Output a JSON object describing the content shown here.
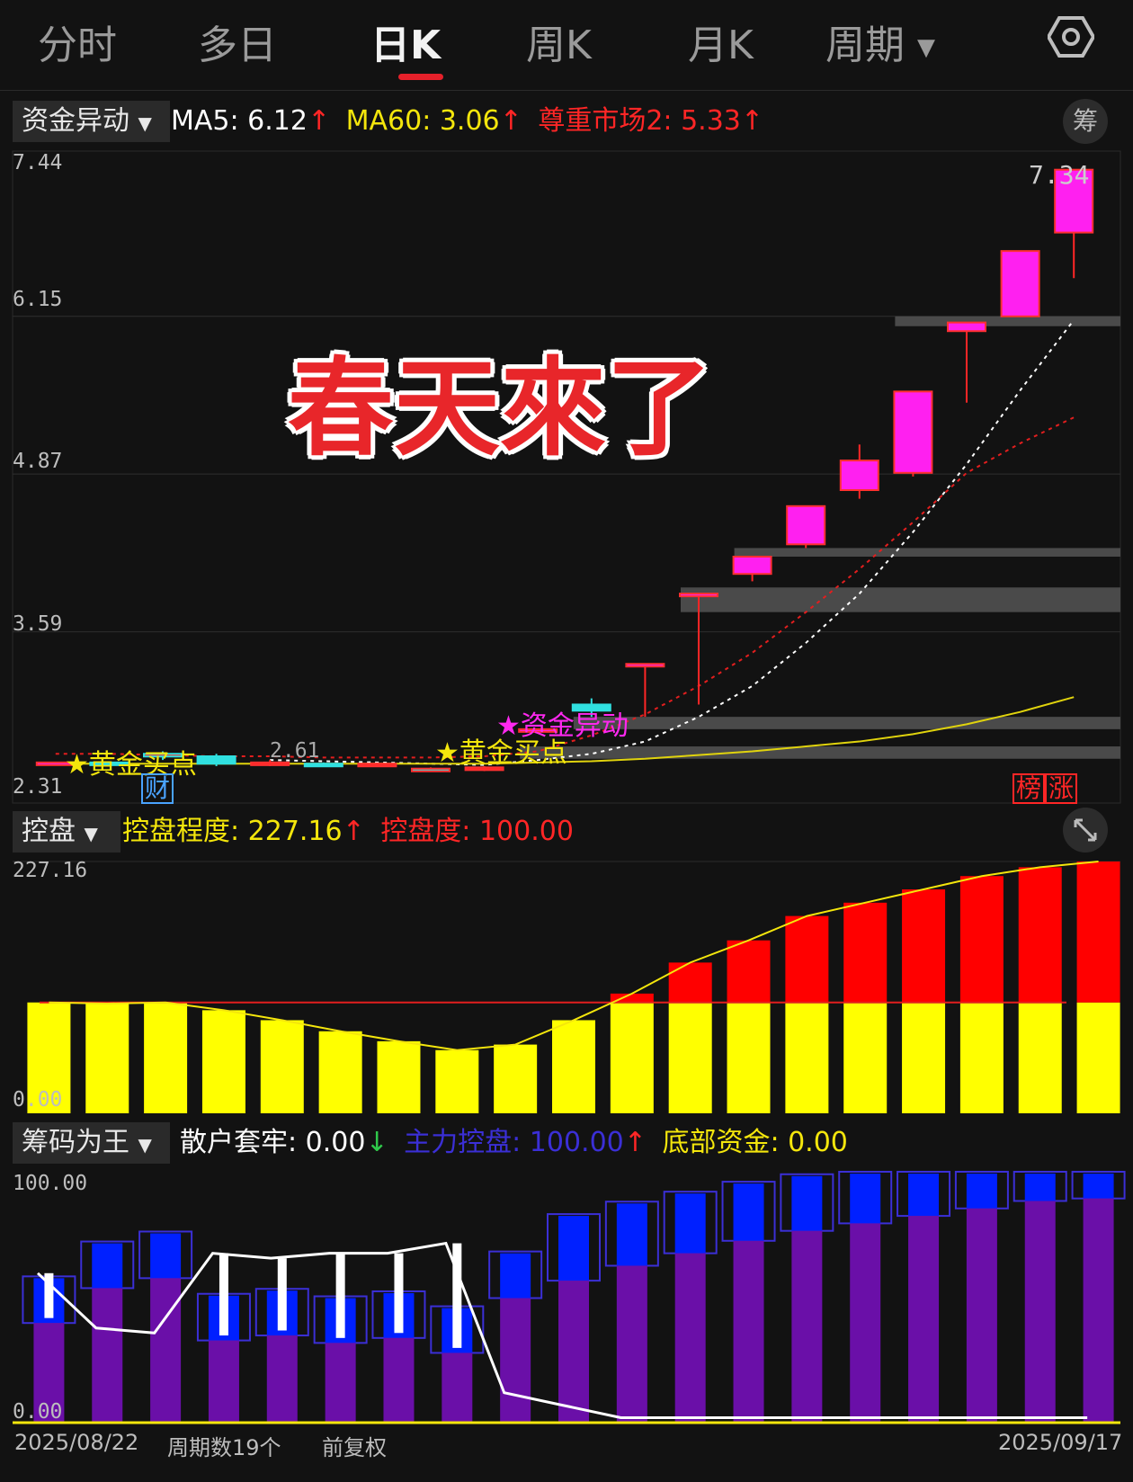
{
  "tabs": [
    {
      "label": "分时",
      "active": false
    },
    {
      "label": "多日",
      "active": false
    },
    {
      "label": "日K",
      "active": true
    },
    {
      "label": "周K",
      "active": false
    },
    {
      "label": "月K",
      "active": false
    },
    {
      "label": "周期",
      "active": false
    }
  ],
  "settings_icon": "gear-icon",
  "main_panel": {
    "selector": "资金异动",
    "indicators": [
      {
        "text": "MA5: 6.12",
        "color": "#ffffff",
        "arrow": "↑"
      },
      {
        "text": "MA60: 3.06",
        "color": "#f4e60c",
        "arrow": "↑"
      },
      {
        "text": "尊重市场2: 5.33",
        "color": "#ff2626",
        "arrow": "↑"
      }
    ],
    "button": "筹",
    "headline": "春天來了",
    "y_labels": [
      "7.44",
      "6.15",
      "4.87",
      "3.59",
      "2.31"
    ],
    "max_label": "7.34",
    "min_label": "2.61",
    "signals": [
      "黄金买点",
      "黄金买点",
      "资金异动"
    ],
    "badges": [
      "财",
      "榜",
      "涨"
    ]
  },
  "control_panel": {
    "selector": "控盘",
    "indicators": [
      {
        "text": "控盘程度: 227.16",
        "color": "#f4e60c",
        "arrow": "↑"
      },
      {
        "text": "控盘度: 100.00",
        "color": "#ff2626",
        "arrow": ""
      }
    ],
    "y_labels": [
      "227.16",
      "0.00"
    ],
    "expand_icon": "expand-icon"
  },
  "chip_panel": {
    "selector": "筹码为王",
    "indicators": [
      {
        "text": "散户套牢: 0.00",
        "color": "#ffffff",
        "arrow": "↓"
      },
      {
        "text": "主力控盘: 100.00",
        "color": "#3b2fd6",
        "arrow": "↑"
      },
      {
        "text": "底部资金: 0.00",
        "color": "#f4e60c",
        "arrow": ""
      }
    ],
    "y_labels": [
      "100.00",
      "0.00"
    ]
  },
  "footer": {
    "start_date": "2025/08/22",
    "period_count": "周期数19个",
    "adjust": "前复权",
    "end_date": "2025/09/17"
  },
  "chart_data": [
    {
      "type": "candlestick",
      "ylim": [
        2.31,
        7.44
      ],
      "categories": [
        "2025/08/22",
        "",
        "",
        "",
        "",
        "",
        "",
        "",
        "",
        "",
        "",
        "",
        "",
        "",
        "",
        "",
        "",
        "",
        "2025/09/17"
      ],
      "series": [
        {
          "name": "candles",
          "values": [
            {
              "o": 2.53,
              "c": 2.53,
              "h": 2.53,
              "l": 2.53
            },
            {
              "o": 2.53,
              "c": 2.52,
              "h": 2.54,
              "l": 2.51
            },
            {
              "o": 2.6,
              "c": 2.58,
              "h": 2.62,
              "l": 2.55
            },
            {
              "o": 2.58,
              "c": 2.52,
              "h": 2.6,
              "l": 2.5
            },
            {
              "o": 2.52,
              "c": 2.53,
              "h": 2.55,
              "l": 2.5
            },
            {
              "o": 2.52,
              "c": 2.51,
              "h": 2.53,
              "l": 2.5
            },
            {
              "o": 2.52,
              "c": 2.52,
              "h": 2.53,
              "l": 2.5
            },
            {
              "o": 2.47,
              "c": 2.48,
              "h": 2.49,
              "l": 2.46
            },
            {
              "o": 2.47,
              "c": 2.49,
              "h": 2.5,
              "l": 2.46
            },
            {
              "o": 2.8,
              "c": 2.8,
              "h": 2.8,
              "l": 2.8
            },
            {
              "o": 3.0,
              "c": 2.95,
              "h": 3.05,
              "l": 2.9
            },
            {
              "o": 3.33,
              "c": 3.33,
              "h": 3.33,
              "l": 2.9
            },
            {
              "o": 3.9,
              "c": 3.9,
              "h": 3.9,
              "l": 3.0
            },
            {
              "o": 4.06,
              "c": 4.2,
              "h": 4.2,
              "l": 4.0
            },
            {
              "o": 4.3,
              "c": 4.61,
              "h": 4.61,
              "l": 4.27
            },
            {
              "o": 4.74,
              "c": 4.98,
              "h": 5.11,
              "l": 4.67
            },
            {
              "o": 4.88,
              "c": 5.54,
              "h": 5.54,
              "l": 4.85
            },
            {
              "o": 6.03,
              "c": 6.1,
              "h": 6.1,
              "l": 5.45
            },
            {
              "o": 6.15,
              "c": 6.68,
              "h": 6.68,
              "l": 6.15
            },
            {
              "o": 6.83,
              "c": 7.34,
              "h": 7.34,
              "l": 6.46
            }
          ]
        },
        {
          "name": "MA5",
          "values": [
            null,
            null,
            null,
            null,
            2.55,
            2.54,
            2.53,
            2.52,
            2.51,
            2.55,
            2.6,
            2.7,
            2.9,
            3.15,
            3.5,
            3.9,
            4.4,
            4.95,
            5.55,
            6.12
          ]
        },
        {
          "name": "MA60",
          "values": [
            2.52,
            2.52,
            2.52,
            2.52,
            2.52,
            2.52,
            2.52,
            2.52,
            2.52,
            2.53,
            2.54,
            2.56,
            2.59,
            2.62,
            2.66,
            2.7,
            2.76,
            2.84,
            2.94,
            3.06
          ]
        },
        {
          "name": "尊重市场2",
          "values": [
            2.6,
            2.6,
            2.59,
            2.58,
            2.58,
            2.57,
            2.57,
            2.57,
            2.58,
            2.62,
            2.75,
            2.92,
            3.15,
            3.42,
            3.75,
            4.1,
            4.48,
            4.88,
            5.12,
            5.33
          ]
        }
      ]
    },
    {
      "type": "bar",
      "ylim": [
        0,
        227.16
      ],
      "series": [
        {
          "name": "控盘程度",
          "values": [
            100,
            99,
            100,
            93,
            84,
            74,
            65,
            57,
            62,
            84,
            108,
            136,
            156,
            178,
            190,
            202,
            214,
            222,
            227.16
          ]
        }
      ]
    },
    {
      "type": "bar",
      "ylim": [
        0,
        100
      ],
      "series": [
        {
          "name": "主力控盘",
          "values": [
            40,
            54,
            58,
            33,
            35,
            32,
            34,
            28,
            50,
            57,
            63,
            68,
            73,
            77,
            80,
            83,
            86,
            89,
            90
          ]
        },
        {
          "name": "散户套牢",
          "values": [
            60,
            38,
            36,
            68,
            66,
            68,
            68,
            72,
            12,
            7,
            0,
            0,
            0,
            0,
            0,
            0,
            0,
            0,
            0
          ]
        }
      ]
    }
  ]
}
